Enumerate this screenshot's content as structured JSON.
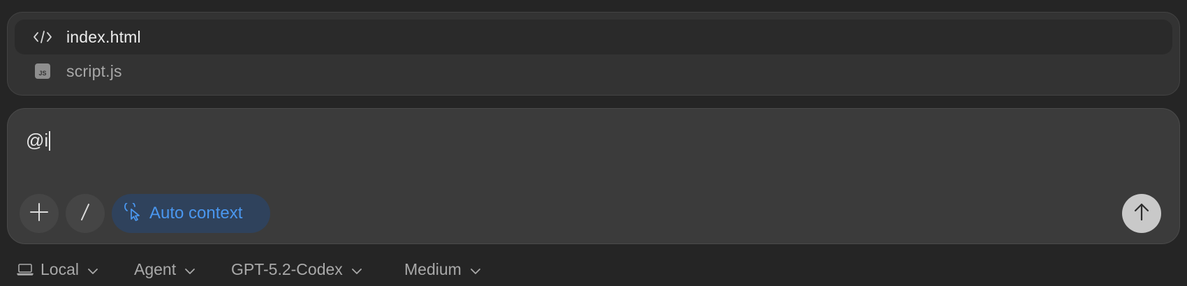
{
  "suggestions": {
    "items": [
      {
        "label": "index.html",
        "icon": "code-icon",
        "selected": true
      },
      {
        "label": "script.js",
        "icon": "js-file-icon",
        "badge": "JS",
        "selected": false
      }
    ]
  },
  "composer": {
    "input_value": "@i",
    "add_icon": "plus-icon",
    "slash_icon": "slash-icon",
    "auto_context": {
      "label": "Auto context",
      "icon": "cursor-click-icon",
      "color": "#4a97ef"
    },
    "send_icon": "arrow-up-icon"
  },
  "toolbar": {
    "environment": {
      "label": "Local",
      "icon": "laptop-icon"
    },
    "mode": {
      "label": "Agent"
    },
    "model": {
      "label": "GPT-5.2-Codex"
    },
    "reasoning": {
      "label": "Medium"
    }
  }
}
